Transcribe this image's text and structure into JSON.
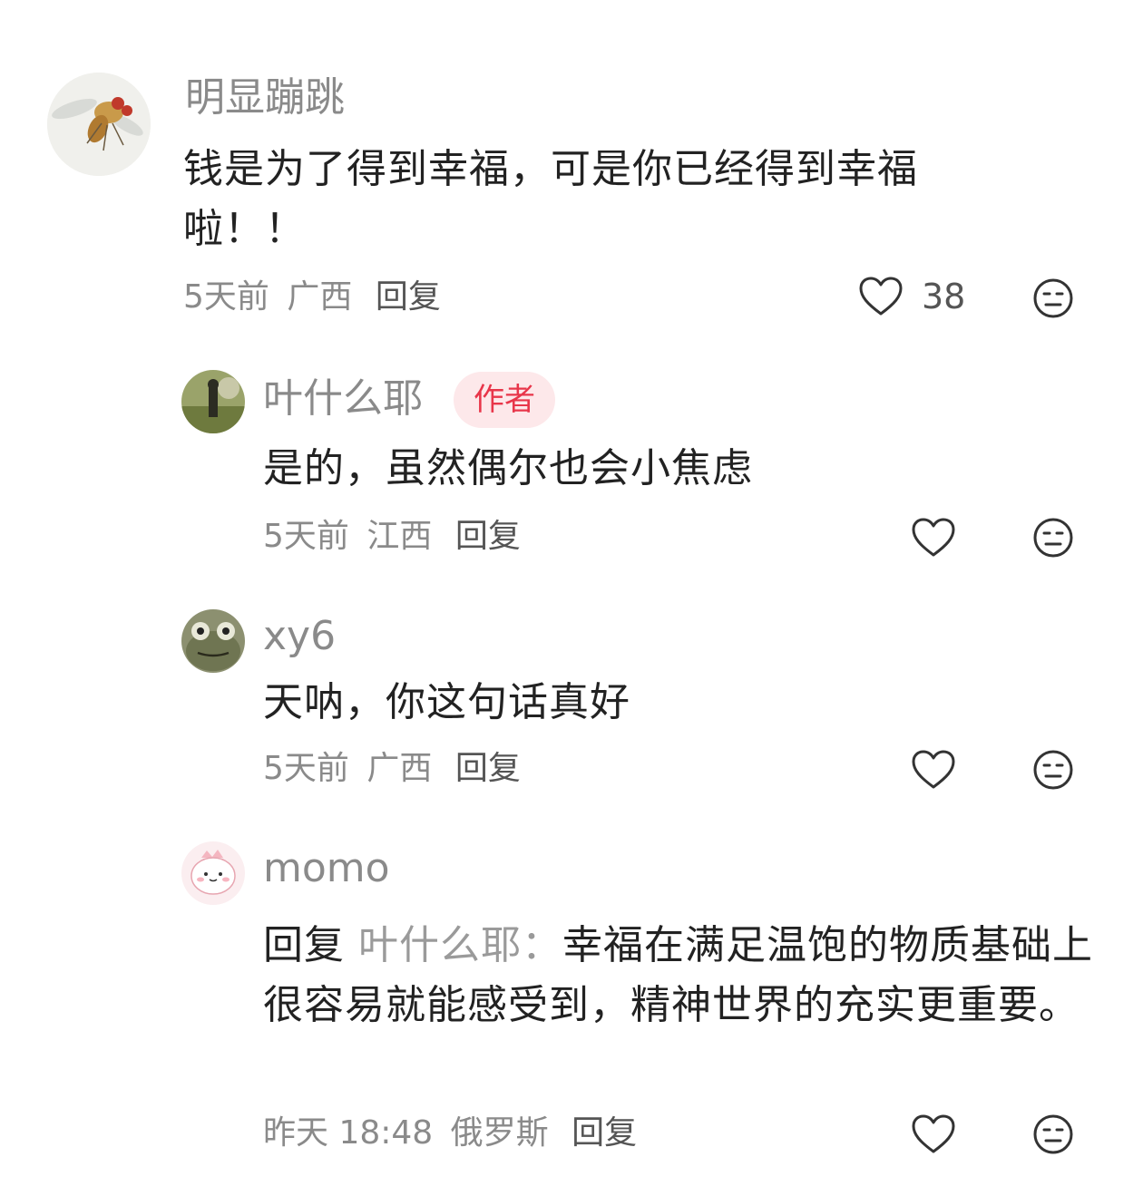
{
  "comments": [
    {
      "username": "明显蹦跳",
      "text": "钱是为了得到幸福，可是你已经得到幸福啦！！",
      "time": "5天前",
      "location": "广西",
      "reply_label": "回复",
      "likes": "38"
    },
    {
      "username": "叶什么耶",
      "badge": "作者",
      "text": "是的，虽然偶尔也会小焦虑",
      "time": "5天前",
      "location": "江西",
      "reply_label": "回复"
    },
    {
      "username": "xy6",
      "text": "天呐，你这句话真好",
      "time": "5天前",
      "location": "广西",
      "reply_label": "回复"
    },
    {
      "username": "momo",
      "reply_prefix": "回复",
      "reply_target": "叶什么耶：",
      "text": "幸福在满足温饱的物质基础上很容易就能感受到，精神世界的充实更重要。",
      "time": "昨天 18:48",
      "location": "俄罗斯",
      "reply_label": "回复"
    }
  ],
  "icons": {
    "like": "heart-outline-icon",
    "dislike": "neutral-face-icon"
  },
  "colors": {
    "badge_bg": "#fde8ea",
    "badge_text": "#e8364a",
    "meta_text": "#8a8a8a",
    "body_text": "#222222"
  }
}
